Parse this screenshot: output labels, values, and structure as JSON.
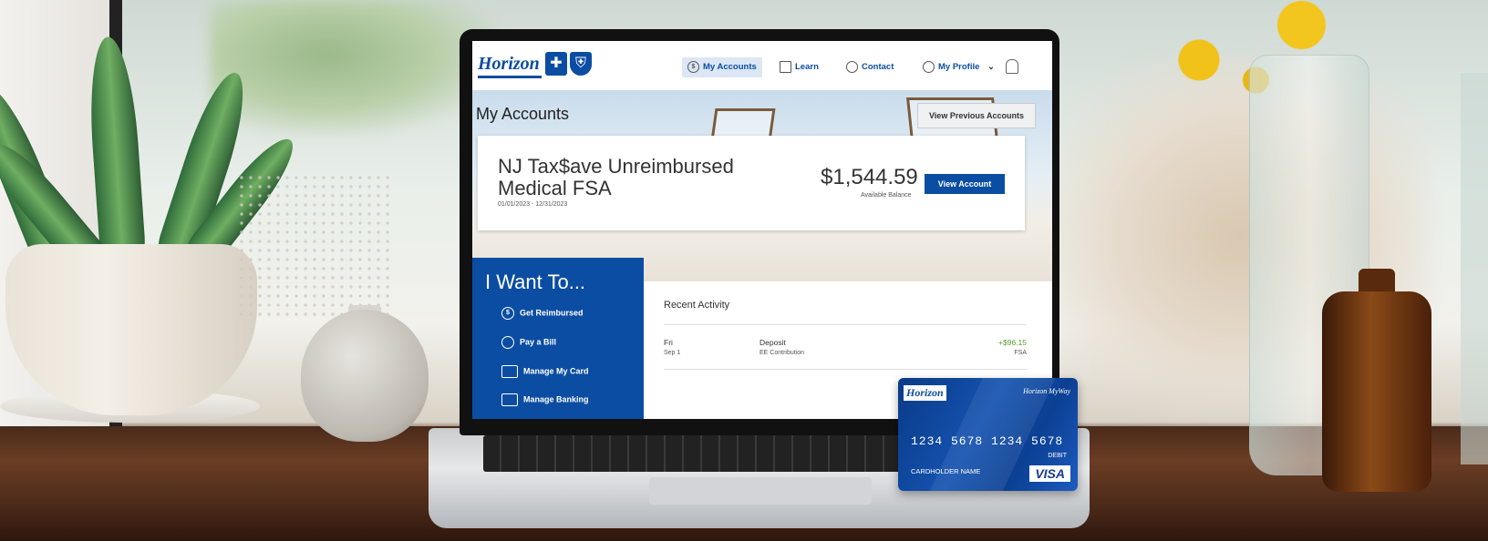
{
  "screen": {
    "nav": {
      "brand": "Horizon",
      "items": [
        "My Accounts",
        "Learn",
        "Contact",
        "My Profile"
      ]
    },
    "page_title": "My Accounts",
    "previous_button": "View Previous Accounts",
    "account": {
      "name": "NJ Tax$ave Unreimbursed Medical FSA",
      "dates": "01/01/2023 - 12/31/2023",
      "balance": "$1,544.59",
      "balance_label": "Available Balance",
      "view_button": "View Account"
    },
    "i_want_to": {
      "title": "I Want To...",
      "items": [
        "Get Reimbursed",
        "Pay a Bill",
        "Manage My Card",
        "Manage Banking"
      ]
    },
    "recent_activity": {
      "title": "Recent Activity",
      "row": {
        "day": "Fri",
        "date": "Sep 1",
        "type": "Deposit",
        "desc": "EE Contribution",
        "amount": "+$96.15",
        "account": "FSA"
      }
    }
  },
  "card": {
    "brand": "Horizon",
    "product": "Horizon MyWay",
    "number": "1234 5678 1234 5678",
    "type": "DEBIT",
    "holder": "CARDHOLDER NAME",
    "network": "VISA"
  },
  "colors": {
    "brand_blue": "#0b4da2",
    "deposit_green": "#5a9a2a"
  }
}
